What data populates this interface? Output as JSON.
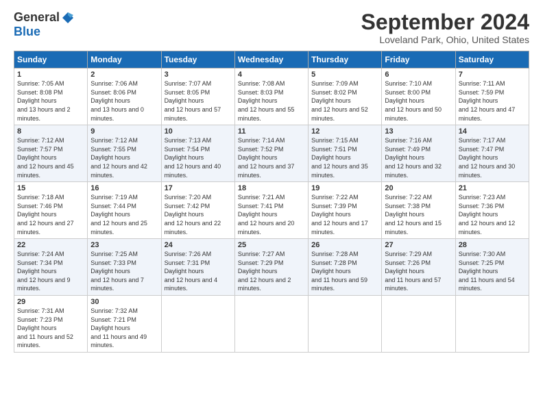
{
  "header": {
    "logo_general": "General",
    "logo_blue": "Blue",
    "title": "September 2024",
    "location": "Loveland Park, Ohio, United States"
  },
  "days_of_week": [
    "Sunday",
    "Monday",
    "Tuesday",
    "Wednesday",
    "Thursday",
    "Friday",
    "Saturday"
  ],
  "weeks": [
    [
      {
        "day": "1",
        "sunrise": "7:05 AM",
        "sunset": "8:08 PM",
        "daylight": "13 hours and 2 minutes."
      },
      {
        "day": "2",
        "sunrise": "7:06 AM",
        "sunset": "8:06 PM",
        "daylight": "13 hours and 0 minutes."
      },
      {
        "day": "3",
        "sunrise": "7:07 AM",
        "sunset": "8:05 PM",
        "daylight": "12 hours and 57 minutes."
      },
      {
        "day": "4",
        "sunrise": "7:08 AM",
        "sunset": "8:03 PM",
        "daylight": "12 hours and 55 minutes."
      },
      {
        "day": "5",
        "sunrise": "7:09 AM",
        "sunset": "8:02 PM",
        "daylight": "12 hours and 52 minutes."
      },
      {
        "day": "6",
        "sunrise": "7:10 AM",
        "sunset": "8:00 PM",
        "daylight": "12 hours and 50 minutes."
      },
      {
        "day": "7",
        "sunrise": "7:11 AM",
        "sunset": "7:59 PM",
        "daylight": "12 hours and 47 minutes."
      }
    ],
    [
      {
        "day": "8",
        "sunrise": "7:12 AM",
        "sunset": "7:57 PM",
        "daylight": "12 hours and 45 minutes."
      },
      {
        "day": "9",
        "sunrise": "7:12 AM",
        "sunset": "7:55 PM",
        "daylight": "12 hours and 42 minutes."
      },
      {
        "day": "10",
        "sunrise": "7:13 AM",
        "sunset": "7:54 PM",
        "daylight": "12 hours and 40 minutes."
      },
      {
        "day": "11",
        "sunrise": "7:14 AM",
        "sunset": "7:52 PM",
        "daylight": "12 hours and 37 minutes."
      },
      {
        "day": "12",
        "sunrise": "7:15 AM",
        "sunset": "7:51 PM",
        "daylight": "12 hours and 35 minutes."
      },
      {
        "day": "13",
        "sunrise": "7:16 AM",
        "sunset": "7:49 PM",
        "daylight": "12 hours and 32 minutes."
      },
      {
        "day": "14",
        "sunrise": "7:17 AM",
        "sunset": "7:47 PM",
        "daylight": "12 hours and 30 minutes."
      }
    ],
    [
      {
        "day": "15",
        "sunrise": "7:18 AM",
        "sunset": "7:46 PM",
        "daylight": "12 hours and 27 minutes."
      },
      {
        "day": "16",
        "sunrise": "7:19 AM",
        "sunset": "7:44 PM",
        "daylight": "12 hours and 25 minutes."
      },
      {
        "day": "17",
        "sunrise": "7:20 AM",
        "sunset": "7:42 PM",
        "daylight": "12 hours and 22 minutes."
      },
      {
        "day": "18",
        "sunrise": "7:21 AM",
        "sunset": "7:41 PM",
        "daylight": "12 hours and 20 minutes."
      },
      {
        "day": "19",
        "sunrise": "7:22 AM",
        "sunset": "7:39 PM",
        "daylight": "12 hours and 17 minutes."
      },
      {
        "day": "20",
        "sunrise": "7:22 AM",
        "sunset": "7:38 PM",
        "daylight": "12 hours and 15 minutes."
      },
      {
        "day": "21",
        "sunrise": "7:23 AM",
        "sunset": "7:36 PM",
        "daylight": "12 hours and 12 minutes."
      }
    ],
    [
      {
        "day": "22",
        "sunrise": "7:24 AM",
        "sunset": "7:34 PM",
        "daylight": "12 hours and 9 minutes."
      },
      {
        "day": "23",
        "sunrise": "7:25 AM",
        "sunset": "7:33 PM",
        "daylight": "12 hours and 7 minutes."
      },
      {
        "day": "24",
        "sunrise": "7:26 AM",
        "sunset": "7:31 PM",
        "daylight": "12 hours and 4 minutes."
      },
      {
        "day": "25",
        "sunrise": "7:27 AM",
        "sunset": "7:29 PM",
        "daylight": "12 hours and 2 minutes."
      },
      {
        "day": "26",
        "sunrise": "7:28 AM",
        "sunset": "7:28 PM",
        "daylight": "11 hours and 59 minutes."
      },
      {
        "day": "27",
        "sunrise": "7:29 AM",
        "sunset": "7:26 PM",
        "daylight": "11 hours and 57 minutes."
      },
      {
        "day": "28",
        "sunrise": "7:30 AM",
        "sunset": "7:25 PM",
        "daylight": "11 hours and 54 minutes."
      }
    ],
    [
      {
        "day": "29",
        "sunrise": "7:31 AM",
        "sunset": "7:23 PM",
        "daylight": "11 hours and 52 minutes."
      },
      {
        "day": "30",
        "sunrise": "7:32 AM",
        "sunset": "7:21 PM",
        "daylight": "11 hours and 49 minutes."
      },
      null,
      null,
      null,
      null,
      null
    ]
  ]
}
